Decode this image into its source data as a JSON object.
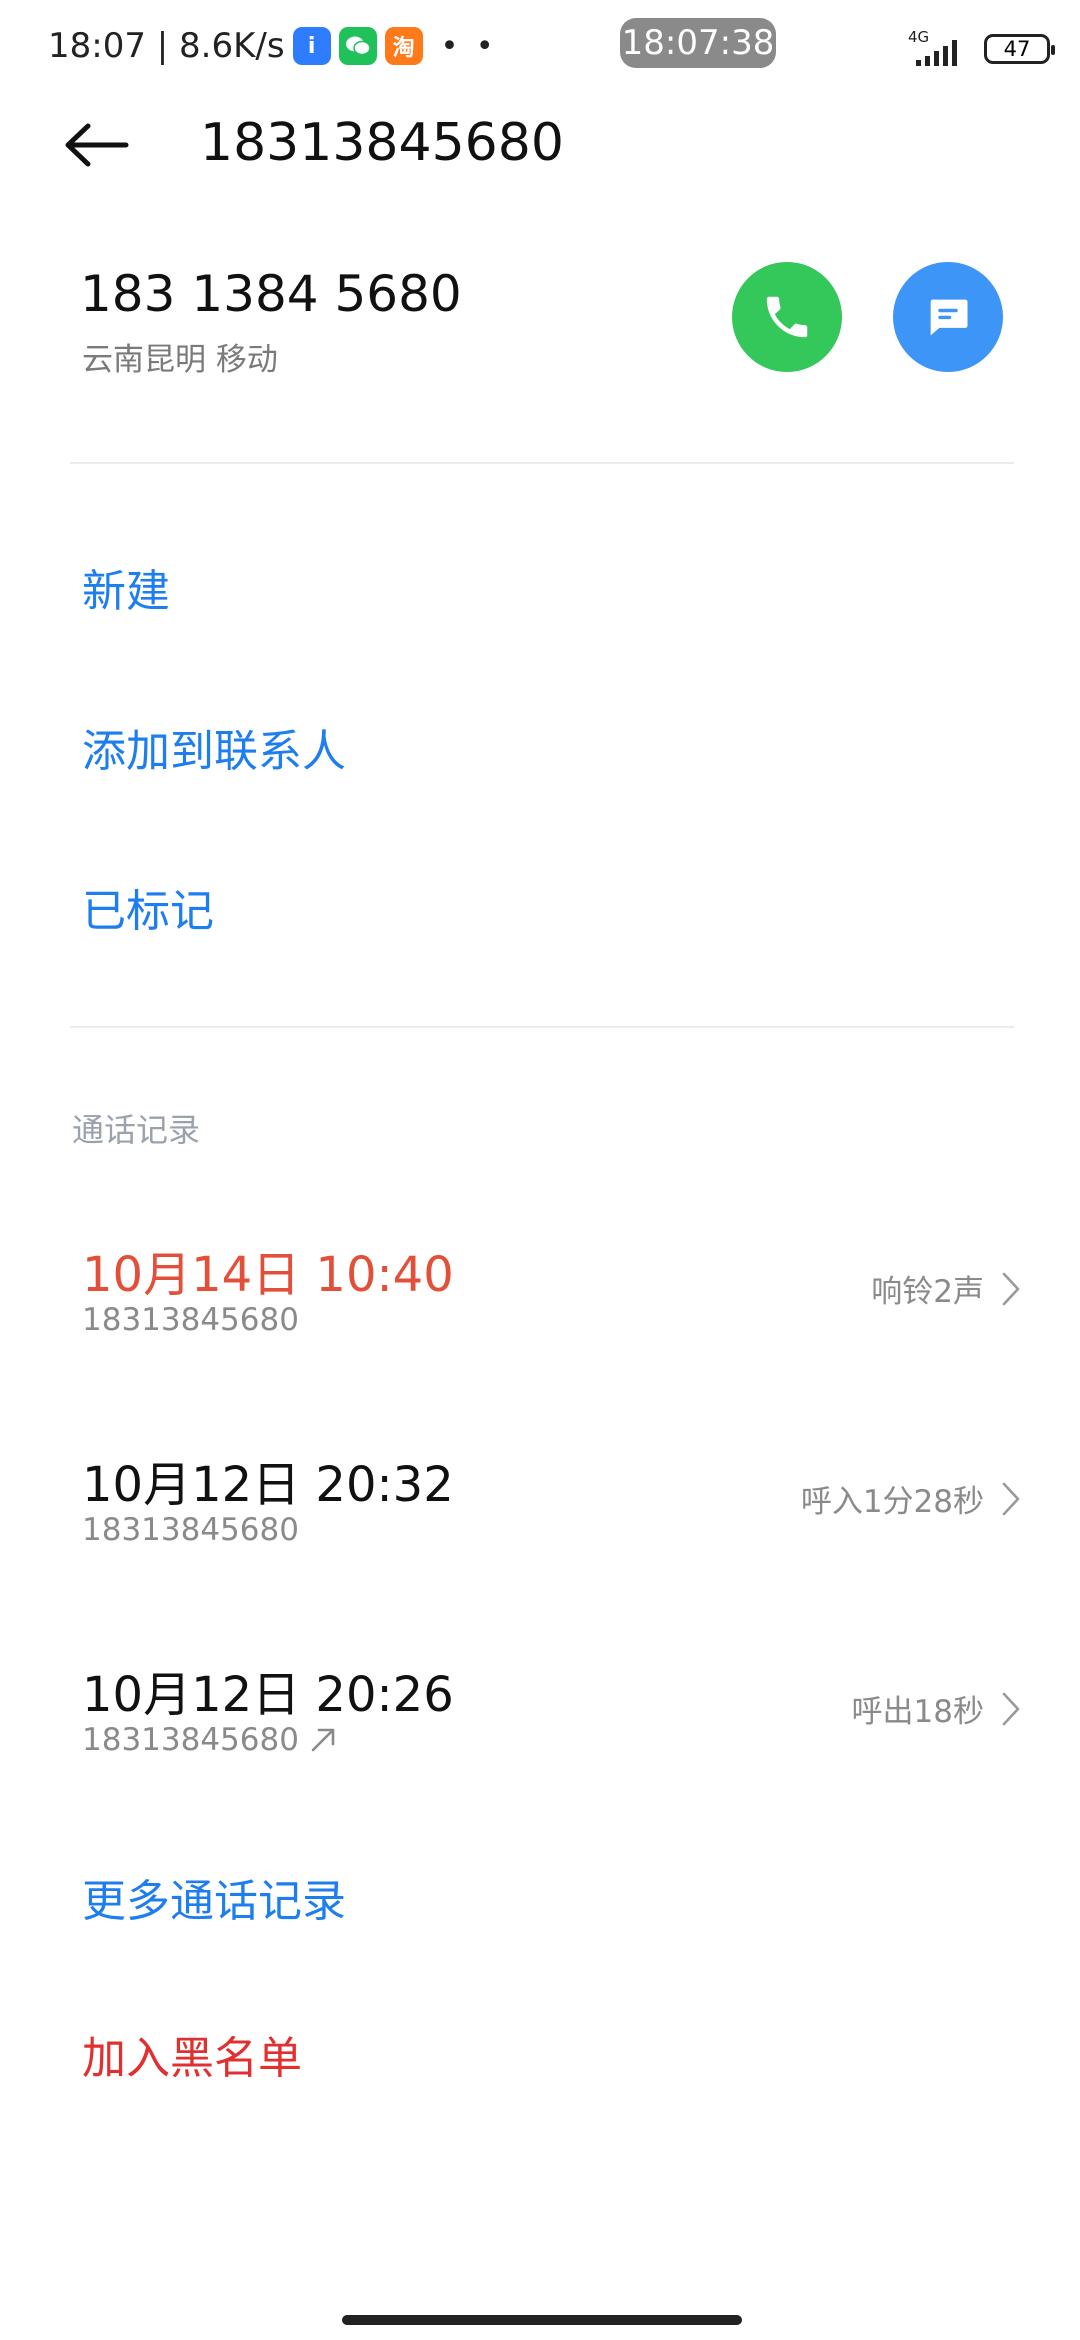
{
  "status_bar": {
    "left_text": "18:07 | 8.6K/s",
    "apps": [
      {
        "icon": "blue-app-icon",
        "glyph": "i",
        "color": "#2f7dff"
      },
      {
        "icon": "wechat-icon",
        "glyph": "◉",
        "color": "#20c15a"
      },
      {
        "icon": "taobao-icon",
        "glyph": "淘",
        "color": "#ff7a1a"
      }
    ],
    "dots": "• •",
    "center_time": "18:07:38",
    "network": "4G",
    "battery": "47"
  },
  "header": {
    "title": "18313845680"
  },
  "contact": {
    "number_formatted": "183 1384 5680",
    "location": "云南昆明 移动",
    "call_color": "#34c759",
    "message_color": "#3d95f7"
  },
  "actions": {
    "new": "新建",
    "add_to_contacts": "添加到联系人",
    "marked": "已标记"
  },
  "call_log": {
    "label": "通话记录",
    "records": [
      {
        "datetime": "10月14日 10:40",
        "number": "18313845680",
        "detail": "响铃2声",
        "missed": true
      },
      {
        "datetime": "10月12日 20:32",
        "number": "18313845680",
        "detail": "呼入1分28秒",
        "missed": false
      },
      {
        "datetime": "10月12日 20:26",
        "number": "18313845680",
        "detail": "呼出18秒",
        "missed": false,
        "outgoing_icon": "outgoing-arrow-icon"
      }
    ],
    "more": "更多通话记录"
  },
  "blacklist": {
    "label": "加入黑名单",
    "color": "#e03030"
  }
}
